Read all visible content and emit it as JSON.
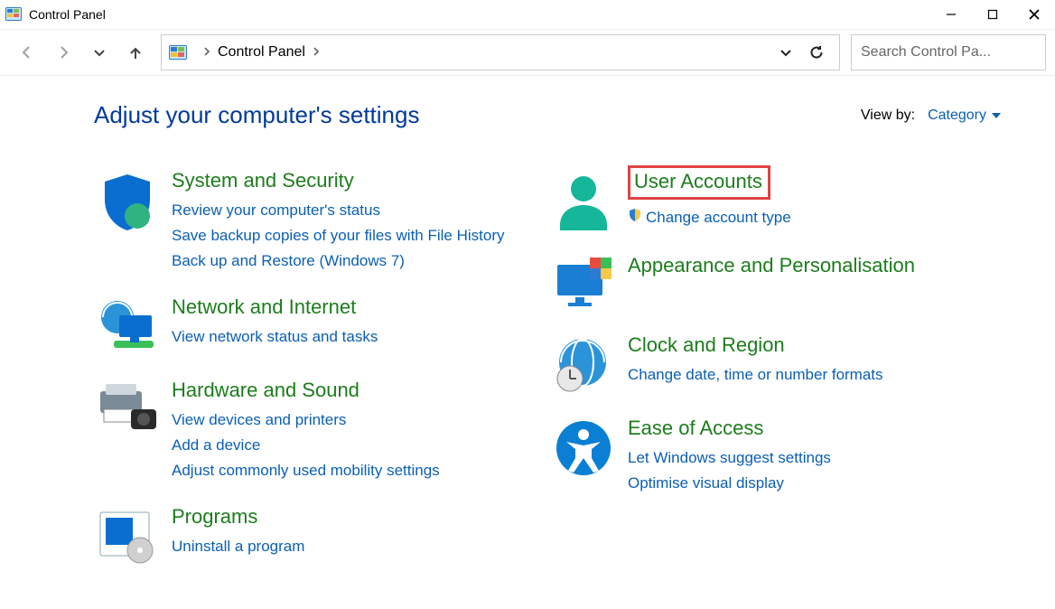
{
  "window": {
    "title": "Control Panel"
  },
  "addressbar": {
    "crumb": "Control Panel"
  },
  "search": {
    "placeholder": "Search Control Pa..."
  },
  "header": {
    "title": "Adjust your computer's settings",
    "viewby_label": "View by:",
    "viewby_value": "Category"
  },
  "categories": {
    "system_security": {
      "title": "System and Security",
      "links": [
        "Review your computer's status",
        "Save backup copies of your files with File History",
        "Back up and Restore (Windows 7)"
      ]
    },
    "network_internet": {
      "title": "Network and Internet",
      "links": [
        "View network status and tasks"
      ]
    },
    "hardware_sound": {
      "title": "Hardware and Sound",
      "links": [
        "View devices and printers",
        "Add a device",
        "Adjust commonly used mobility settings"
      ]
    },
    "programs": {
      "title": "Programs",
      "links": [
        "Uninstall a program"
      ]
    },
    "user_accounts": {
      "title": "User Accounts",
      "links": [
        "Change account type"
      ]
    },
    "appearance": {
      "title": "Appearance and Personalisation"
    },
    "clock_region": {
      "title": "Clock and Region",
      "links": [
        "Change date, time or number formats"
      ]
    },
    "ease_of_access": {
      "title": "Ease of Access",
      "links": [
        "Let Windows suggest settings",
        "Optimise visual display"
      ]
    }
  }
}
